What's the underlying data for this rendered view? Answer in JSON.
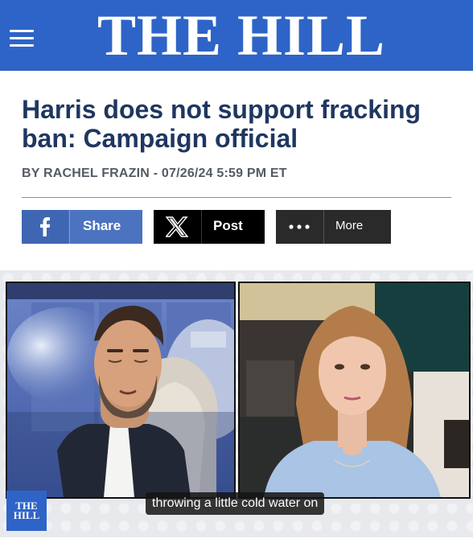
{
  "masthead": {
    "title": "THE HILL",
    "menu_icon": "menu-icon",
    "background": "#2e64c7"
  },
  "article": {
    "headline": "Harris does not support fracking ban: Campaign official",
    "byline": "BY RACHEL FRAZIN - 07/26/24 5:59 PM ET"
  },
  "share": {
    "facebook": {
      "label": "Share",
      "icon": "facebook-icon",
      "color": "#4c73bf"
    },
    "x": {
      "label": "Post",
      "icon": "x-logo-icon",
      "color": "#000000"
    },
    "more": {
      "label": "More",
      "icon": "more-dots-icon",
      "color": "#2a2a2a"
    }
  },
  "video": {
    "caption": "throwing a little cold water on",
    "logo_line1": "THE",
    "logo_line2": "HILL"
  }
}
